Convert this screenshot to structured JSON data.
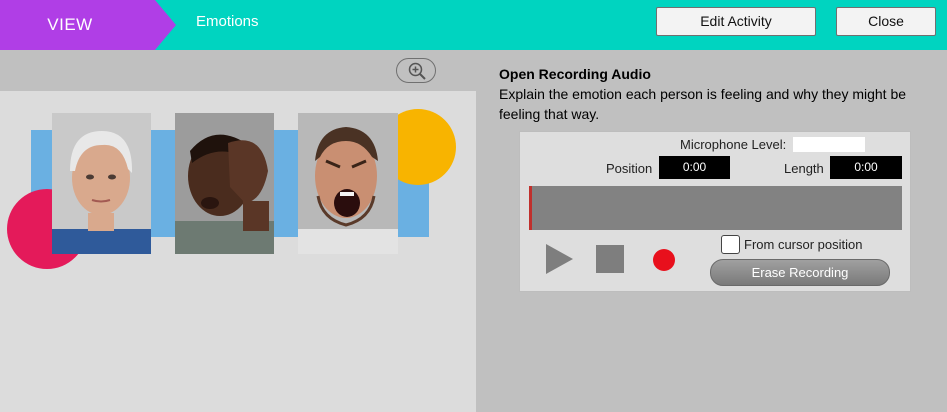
{
  "header": {
    "mode_label": "VIEW",
    "activity_title": "Emotions",
    "edit_button": "Edit Activity",
    "close_button": "Close",
    "colors": {
      "bar": "#00d4c0",
      "mode_tab": "#b03ee6"
    }
  },
  "toolbar": {
    "zoom_icon": "zoom-in-icon"
  },
  "activity_image": {
    "description_icons": [
      "older-woman-portrait",
      "stressed-man-portrait",
      "angry-man-portrait"
    ]
  },
  "prompt": {
    "title": "Open Recording Audio",
    "text": "Explain the emotion each person is feeling and why they might be feeling that way."
  },
  "recorder": {
    "mic_level_label": "Microphone Level:",
    "mic_level": 0,
    "position_label": "Position",
    "position_value": "0:00",
    "length_label": "Length",
    "length_value": "0:00",
    "from_cursor_label": "From cursor position",
    "from_cursor_checked": false,
    "erase_label": "Erase Recording",
    "icons": [
      "play-icon",
      "stop-icon",
      "record-icon"
    ],
    "record_color": "#e8101c"
  }
}
